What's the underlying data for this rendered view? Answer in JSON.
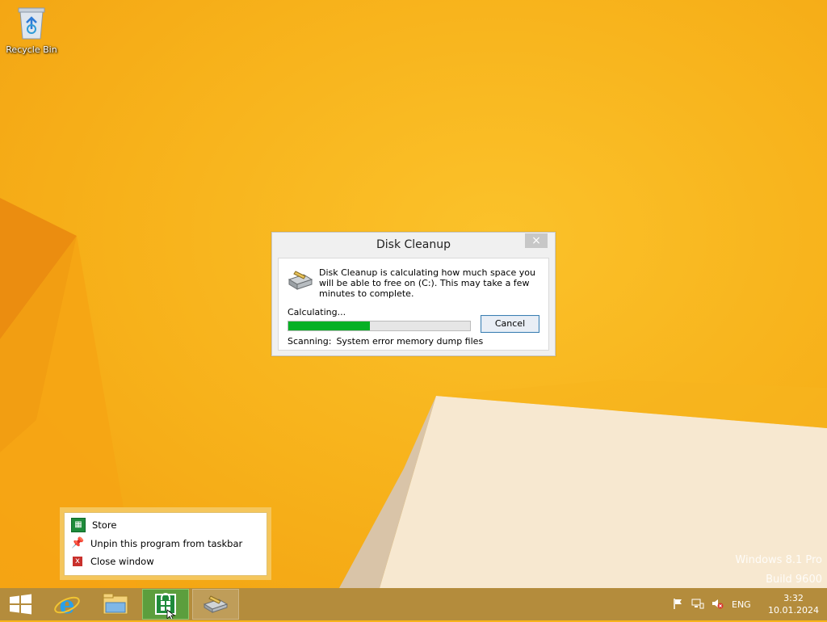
{
  "desktop": {
    "recycle_bin_label": "Recycle Bin",
    "watermark": {
      "line1": "Windows 8.1 Pro",
      "line2": "Build 9600"
    }
  },
  "dialog": {
    "title": "Disk Cleanup",
    "close_glyph": "×",
    "message": "Disk Cleanup is calculating how much space you will be able to free on  (C:). This may take a few minutes to complete.",
    "status": "Calculating...",
    "progress_fraction": 0.45,
    "cancel_label": "Cancel",
    "scan_label": "Scanning:",
    "scan_value": "System error memory dump files"
  },
  "jumplist": {
    "items": [
      {
        "label": "Store",
        "icon": "store-icon"
      },
      {
        "label": "Unpin this program from taskbar",
        "icon": "unpin-icon"
      },
      {
        "label": "Close window",
        "icon": "close-window-icon"
      }
    ]
  },
  "taskbar": {
    "buttons": [
      "start-button",
      "internet-explorer",
      "file-explorer",
      "store",
      "disk-cleanup"
    ],
    "language": "ENG",
    "time": "3:32",
    "date": "10.01.2024"
  },
  "colors": {
    "desktop_bg": "#f8b41a",
    "taskbar_bg": "#b48c3c",
    "progress_fill": "#06b025",
    "store_green": "#1f8b3b"
  }
}
